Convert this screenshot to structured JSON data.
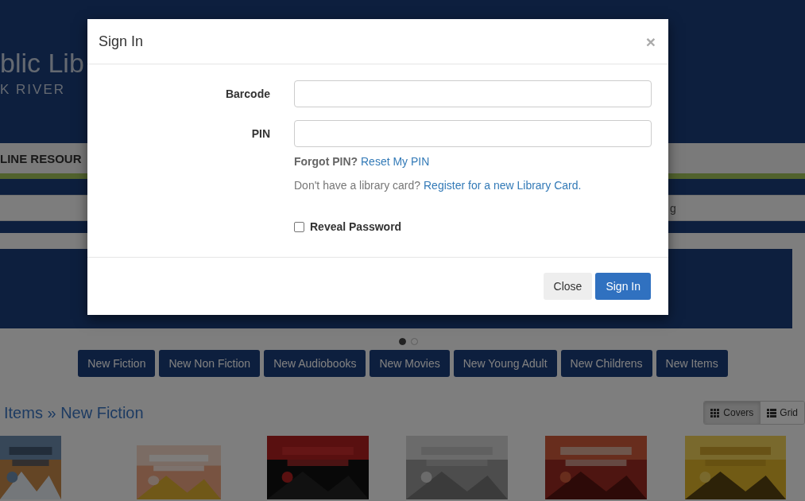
{
  "header": {
    "logo_title": "blic Lib",
    "logo_subtitle": "K RIVER"
  },
  "nav": {
    "item": "LINE RESOUR"
  },
  "search_bar": {
    "text": "g"
  },
  "carousel": {
    "dots": [
      {
        "selected": true
      },
      {
        "selected": false
      }
    ]
  },
  "collection_buttons": [
    "New Fiction",
    "New Non Fiction",
    "New Audiobooks",
    "New Movies",
    "New Young Adult",
    "New Childrens",
    "New Items"
  ],
  "section": {
    "title": "Items » New Fiction",
    "view_toggle": [
      {
        "label": "Covers",
        "kind": "covers",
        "selected": true
      },
      {
        "label": "Grid",
        "kind": "grid",
        "selected": false
      }
    ]
  },
  "dialog": {
    "title": "Sign In",
    "close": "×",
    "fields": [
      {
        "label": "Barcode"
      },
      {
        "label": "PIN"
      }
    ],
    "forgot": {
      "text": "Forgot PIN?",
      "link": "Reset My PIN"
    },
    "register": {
      "text": "Don't have a library card?",
      "link": "Register for a new Library Card."
    },
    "reveal": {
      "label": "Reveal Password",
      "checked": false
    },
    "buttons": [
      {
        "label": "Close",
        "kind": "secondary"
      },
      {
        "label": "Sign In",
        "kind": "primary"
      }
    ]
  }
}
